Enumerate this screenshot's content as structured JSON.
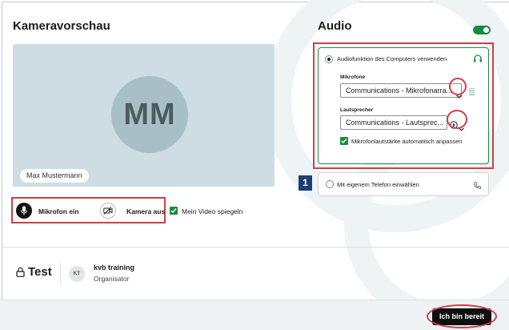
{
  "left": {
    "title": "Kameravorschau",
    "avatar_initials": "MM",
    "participant_name": "Max Mustermann",
    "mic_label": "Mikrofon ein",
    "camera_label": "Kamera aus",
    "mirror_label": "Mein Video spiegeln"
  },
  "audio": {
    "title": "Audio",
    "computer_audio_label": "Audiofunktion des Computers verwenden",
    "mic_section_label": "Mikrofone",
    "mic_value": "Communications - Mikrofonarra...",
    "speaker_section_label": "Lautsprecher",
    "speaker_value": "Communications - Lautsprec...",
    "auto_volume_label": "Mikrofonlautstärke automatisch anpassen",
    "phone_label": "Mit eigenem Telefon einwählen",
    "badge": "1"
  },
  "meeting": {
    "name": "Test",
    "host_initials": "KT",
    "host_name": "kvb training",
    "host_role": "Organisator"
  },
  "footer": {
    "ready_label": "Ich bin bereit"
  },
  "colors": {
    "accent_green": "#178c3e",
    "highlight_red": "#cf3f48",
    "badge_navy": "#1e3f73"
  }
}
